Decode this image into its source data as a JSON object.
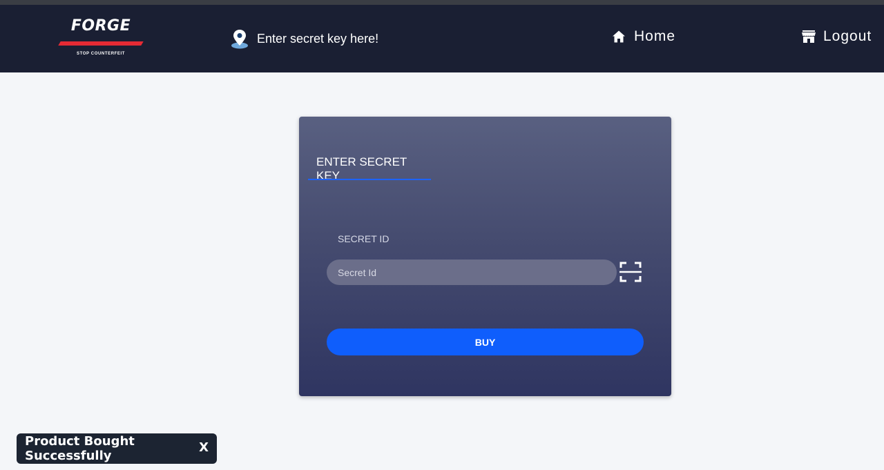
{
  "navbar": {
    "logo": {
      "title": "FORGE",
      "tagline": "STOP COUNTERFEIT"
    },
    "secret_link_label": "Enter secret key here!",
    "home_label": "Home",
    "logout_label": "Logout"
  },
  "card": {
    "tab_label": "ENTER SECRET KEY",
    "field_label": "SECRET ID",
    "input_placeholder": "Secret Id",
    "input_value": "",
    "buy_label": "BUY"
  },
  "toast": {
    "message": "Product Bought Successfully",
    "close_label": "X"
  },
  "colors": {
    "navbar_bg": "#1a1f33",
    "accent_blue": "#0f5efc",
    "logo_red": "#e52a34",
    "page_bg": "#f4f6f9"
  },
  "icons": [
    "location-pin-icon",
    "home-icon",
    "store-icon",
    "scan-icon"
  ]
}
